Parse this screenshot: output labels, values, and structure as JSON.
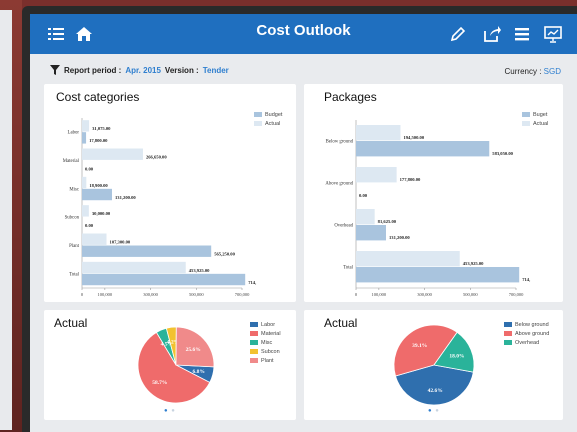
{
  "nav": {
    "title": "Cost Outlook",
    "icons": [
      "list-icon",
      "home-icon",
      "edit-icon",
      "share-icon",
      "menu-icon",
      "presentation-icon"
    ]
  },
  "report": {
    "period_label": "Report period :",
    "period_value": "Apr. 2015",
    "version_label": "Version :",
    "version_value": "Tender",
    "currency_label": "Currency :",
    "currency_value": "SGD"
  },
  "colors": {
    "nav": "#1f6fbf",
    "budget": "#a9c4de",
    "actual": "#dde8f2"
  },
  "cost_categories": {
    "title": "Cost categories",
    "legend": [
      "Budget",
      "Actual"
    ],
    "x_ticks": [
      "0",
      "100,000",
      "300,000",
      "500,000",
      "700,000"
    ]
  },
  "packages": {
    "title": "Packages",
    "legend": [
      "Buget",
      "Actual"
    ],
    "x_ticks": [
      "0",
      "100,000",
      "300,000",
      "500,000",
      "700,000"
    ]
  },
  "actual_left": {
    "title": "Actual",
    "legend": [
      "Labor",
      "Material",
      "Misc",
      "Subcon",
      "Plant"
    ]
  },
  "actual_right": {
    "title": "Actual",
    "legend": [
      "Below ground",
      "Above ground",
      "Overhead"
    ]
  },
  "chart_data": [
    {
      "type": "bar",
      "orientation": "horizontal",
      "title": "Cost categories",
      "categories": [
        "Labor",
        "Material",
        "Misc",
        "Subcon",
        "Plant",
        "Total"
      ],
      "series": [
        {
          "name": "Budget",
          "values": [
            31075,
            266650,
            18900,
            30000,
            107300,
            453925
          ],
          "labels": [
            "31,075.00",
            "266,650.00",
            "18,900.00",
            "30,000.00",
            "107,300.00",
            "453,925.00"
          ]
        },
        {
          "name": "Actual",
          "values": [
            17800,
            0,
            131200,
            0,
            565250,
            714000
          ],
          "labels": [
            "17,800.00",
            "0.00",
            "131,200.00",
            "0.00",
            "565,250.00",
            "714,"
          ]
        }
      ],
      "xlim": [
        0,
        700000
      ]
    },
    {
      "type": "bar",
      "orientation": "horizontal",
      "title": "Packages",
      "categories": [
        "Below ground",
        "Above ground",
        "Overhead",
        "Total"
      ],
      "series": [
        {
          "name": "Buget",
          "values": [
            194500,
            177800,
            81625,
            453925
          ],
          "labels": [
            "194,500.00",
            "177,800.00",
            "81,625.00",
            "453,925.00"
          ]
        },
        {
          "name": "Actual",
          "values": [
            583050,
            0,
            131200,
            714000
          ],
          "labels": [
            "583,050.00",
            "0.00",
            "131,200.00",
            "714,"
          ]
        }
      ],
      "xlim": [
        0,
        700000
      ]
    },
    {
      "type": "pie",
      "title": "Actual",
      "categories": [
        "Labor",
        "Material",
        "Misc",
        "Subcon",
        "Plant"
      ],
      "values": [
        6.8,
        58.7,
        4.5,
        4.2,
        25.6
      ],
      "labels": [
        "6.8%",
        "58.7%",
        "4.5%",
        "4.2%",
        "25.6%"
      ],
      "colors": [
        "#2f6fae",
        "#ef6b6b",
        "#2ab39a",
        "#f2c230",
        "#f08a8a"
      ]
    },
    {
      "type": "pie",
      "title": "Actual",
      "categories": [
        "Below ground",
        "Above ground",
        "Overhead"
      ],
      "values": [
        42.6,
        39.1,
        18.0
      ],
      "labels": [
        "42.6%",
        "39.1%",
        "18.0%"
      ],
      "colors": [
        "#2f6fae",
        "#ef6b6b",
        "#2ab39a"
      ]
    }
  ]
}
